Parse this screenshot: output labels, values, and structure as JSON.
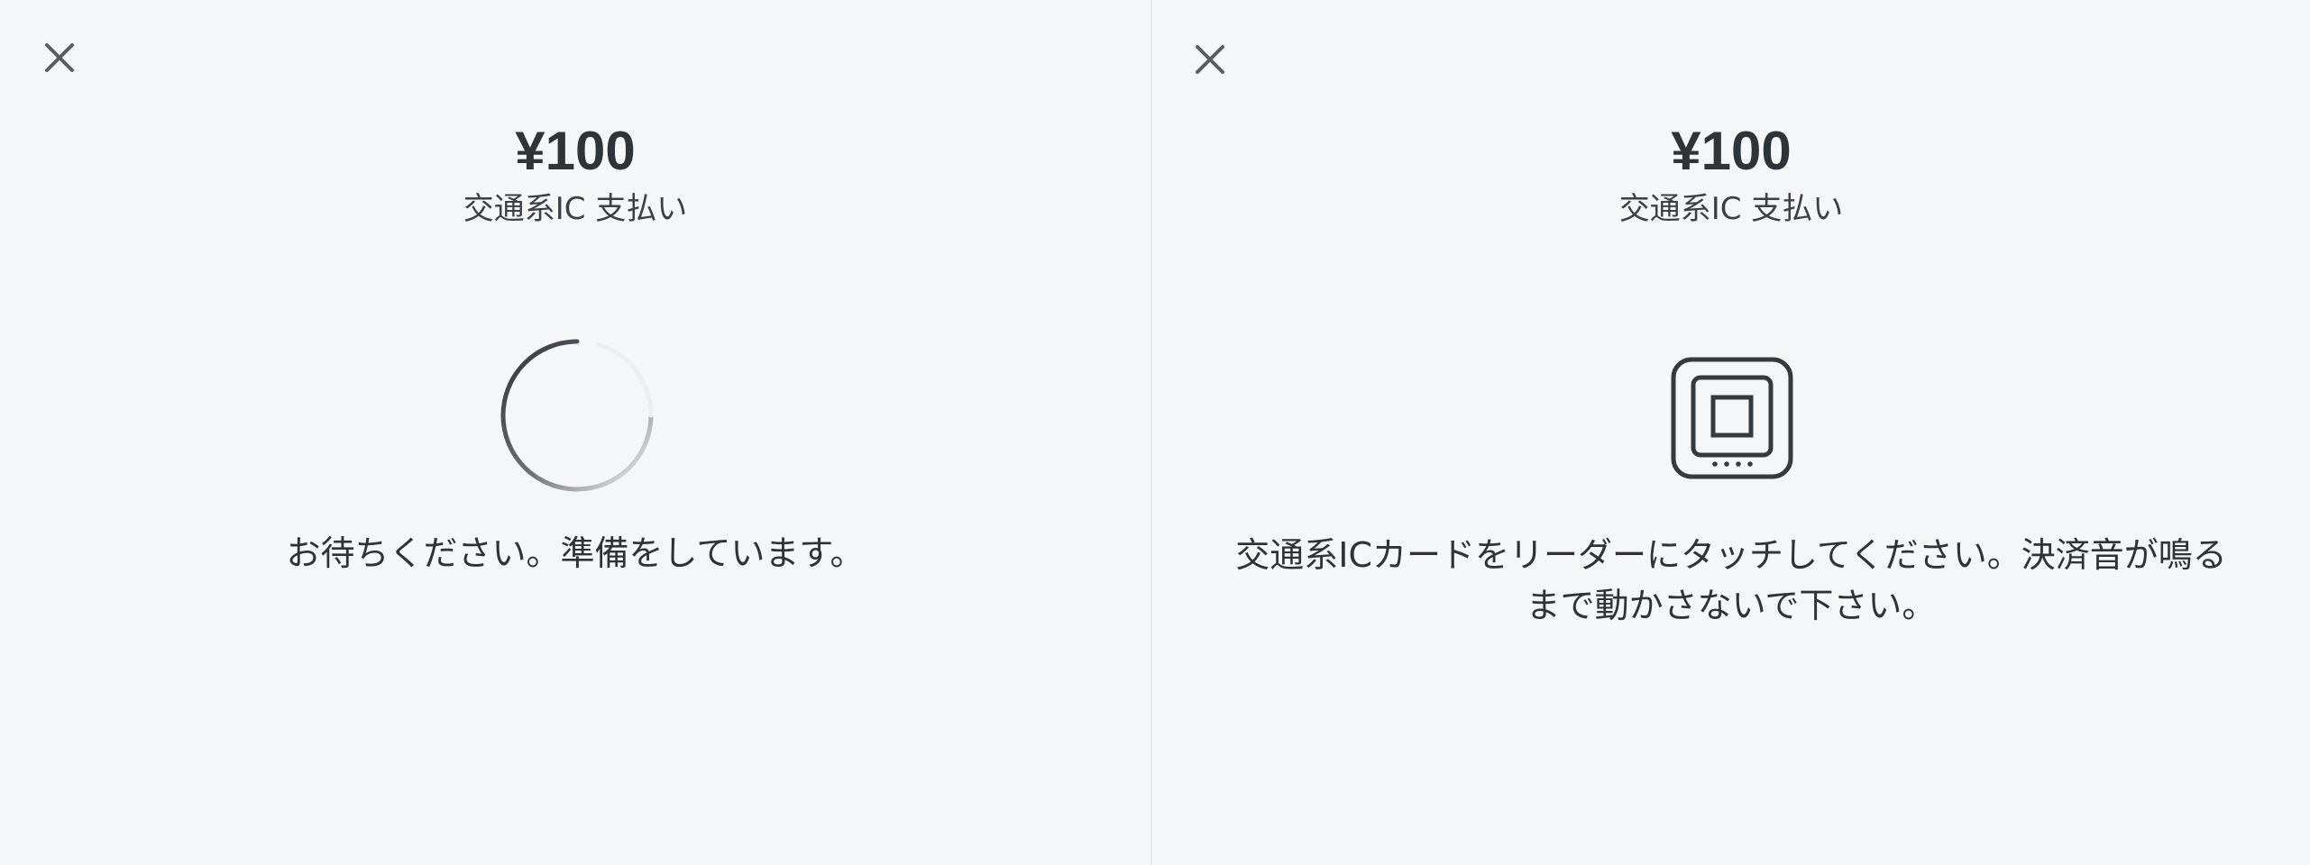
{
  "left_panel": {
    "close_icon": "close-icon",
    "amount": "¥100",
    "method": "交通系IC 支払い",
    "status_icon": "loading-spinner",
    "message": "お待ちください。準備をしています。"
  },
  "right_panel": {
    "close_icon": "close-icon",
    "amount": "¥100",
    "method": "交通系IC 支払い",
    "status_icon": "card-reader-icon",
    "message_line1": "交通系ICカードをリーダーにタッチしてください。決済音が鳴る",
    "message_line2": "まで動かさないで下さい。"
  },
  "colors": {
    "background": "#f5f6f8",
    "text": "#2f3337",
    "icon": "#3a3f44",
    "divider": "#e6e8eb"
  }
}
